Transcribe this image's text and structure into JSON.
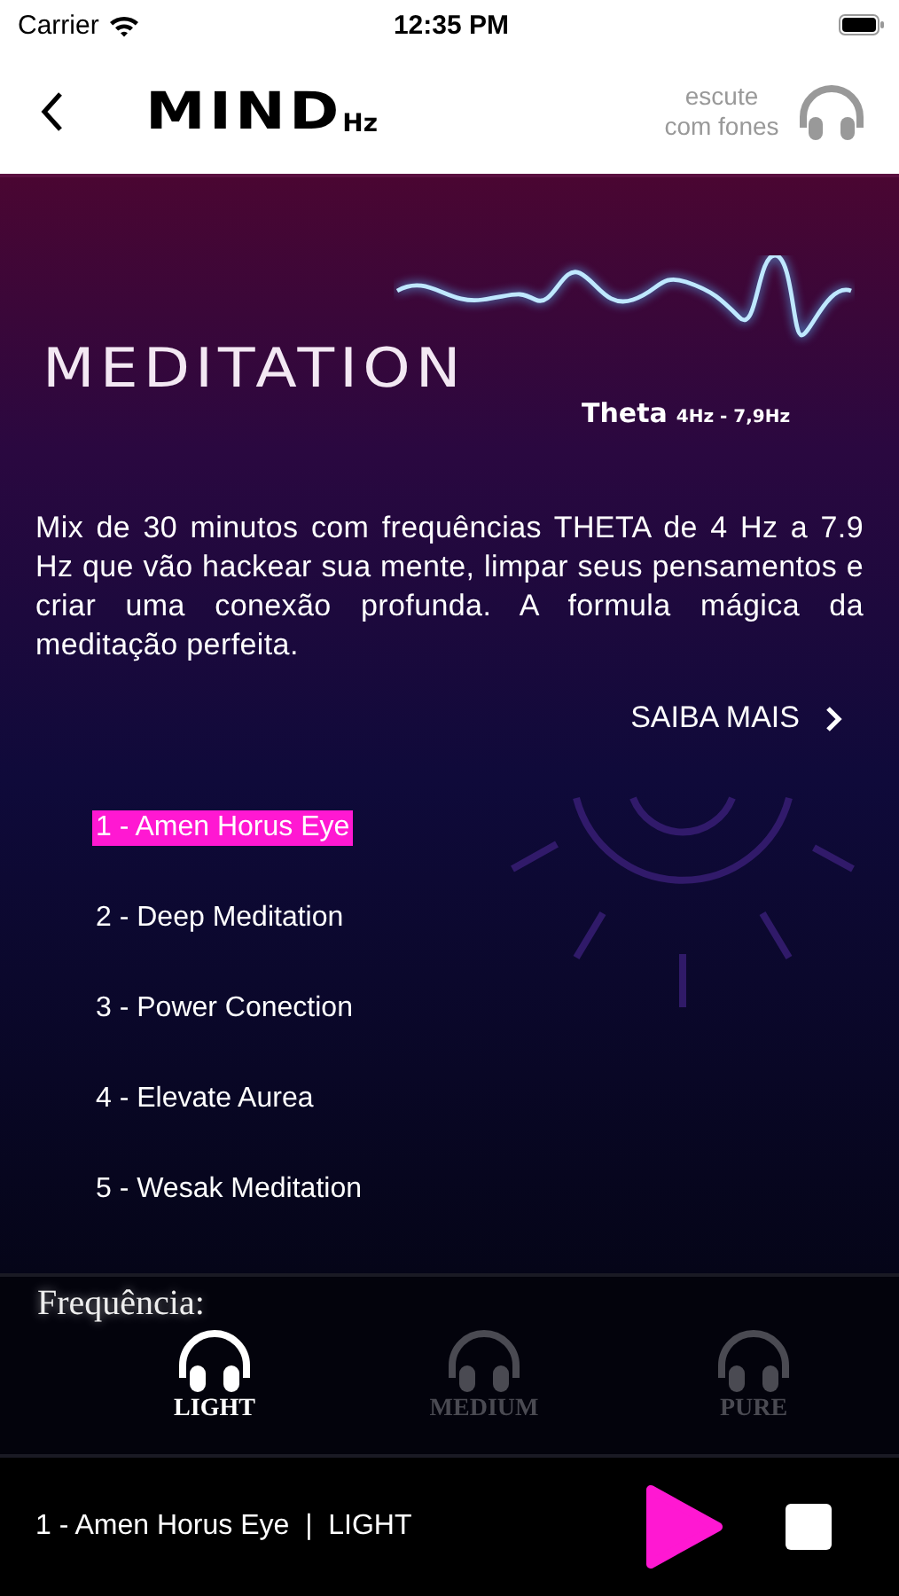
{
  "status_bar": {
    "carrier": "Carrier",
    "time": "12:35 PM"
  },
  "header": {
    "logo": "MIND",
    "logo_suffix": "Hz",
    "hint": "escute com fones"
  },
  "hero": {
    "title": "MEDITATION",
    "band": "Theta",
    "range": "4Hz - 7,9Hz"
  },
  "description": "Mix de 30 minutos com frequências THETA de 4 Hz a 7.9 Hz que vão hackear sua mente, limpar seus pensamentos e criar uma conexão profunda. A formula mágica da meditação perfeita.",
  "more_link": "SAIBA MAIS",
  "tracks": [
    {
      "label": "1 - Amen Horus Eye",
      "selected": true
    },
    {
      "label": "2 - Deep Meditation",
      "selected": false
    },
    {
      "label": "3 - Power Conection",
      "selected": false
    },
    {
      "label": "4 - Elevate Aurea",
      "selected": false
    },
    {
      "label": "5 - Wesak Meditation",
      "selected": false
    }
  ],
  "frequency": {
    "label": "Frequência:",
    "options": [
      {
        "label": "LIGHT",
        "selected": true
      },
      {
        "label": "MEDIUM",
        "selected": false
      },
      {
        "label": "PURE",
        "selected": false
      }
    ]
  },
  "player": {
    "now_playing": "1 - Amen Horus Eye  |  LIGHT"
  }
}
